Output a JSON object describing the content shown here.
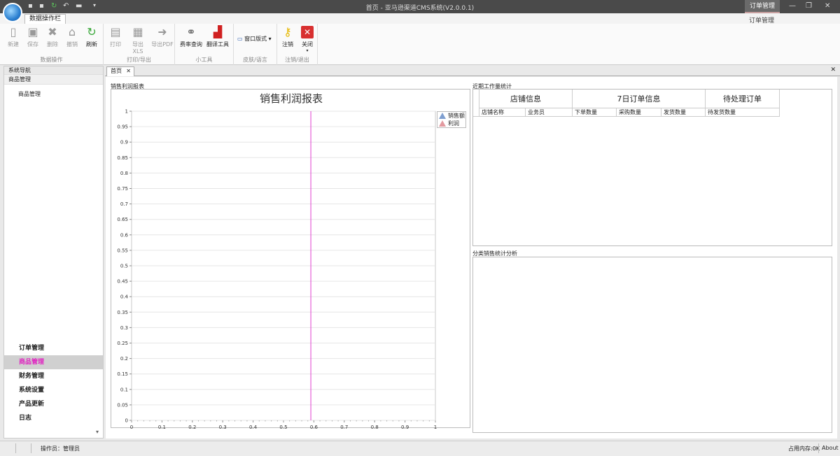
{
  "window": {
    "title": "首页 - 亚马逊渠道CMS系统(V2.0.0.1)",
    "context_tab": "订单管理",
    "context_group": "订单管理"
  },
  "ribbon": {
    "tab": "数据操作栏",
    "groups": [
      {
        "label": "数据操作",
        "buttons": [
          "新建",
          "保存",
          "删除",
          "撤销",
          "刷新"
        ]
      },
      {
        "label": "打印/导出",
        "buttons": [
          "打印",
          "导出XLS",
          "导出PDF"
        ]
      },
      {
        "label": "小工具",
        "buttons": [
          "费率查询",
          "翻译工具"
        ]
      },
      {
        "label": "皮肤/语言",
        "buttons": [
          "窗口版式"
        ]
      },
      {
        "label": "注销/退出",
        "buttons": [
          "注销",
          "关闭"
        ]
      }
    ]
  },
  "nav": {
    "header": "系统导航",
    "group_title": "商品管理",
    "sub_item": "商品管理",
    "groups": [
      "订单管理",
      "商品管理",
      "财务管理",
      "系统设置",
      "产品更新",
      "日志"
    ],
    "active_group": "商品管理"
  },
  "doc_tab": {
    "label": "首页"
  },
  "sales_panel": {
    "title": "销售利润报表"
  },
  "chart_data": {
    "type": "line",
    "title": "销售利润报表",
    "series": [
      {
        "name": "销售额",
        "color": "#7f9fd0",
        "values": []
      },
      {
        "name": "利润",
        "color": "#e39aa0",
        "values": []
      }
    ],
    "xlim": [
      0,
      1
    ],
    "ylim": [
      0,
      1
    ],
    "xticks": [
      "0",
      "0.1",
      "0.2",
      "0.3",
      "0.4",
      "0.5",
      "0.6",
      "0.7",
      "0.8",
      "0.9",
      "1"
    ],
    "yticks": [
      "0",
      "0.05",
      "0.1",
      "0.15",
      "0.2",
      "0.25",
      "0.3",
      "0.35",
      "0.4",
      "0.45",
      "0.5",
      "0.55",
      "0.6",
      "0.65",
      "0.7",
      "0.75",
      "0.8",
      "0.85",
      "0.9",
      "0.95",
      "1"
    ],
    "cursor_x": 0.59,
    "cursor_color": "#e040d0",
    "grid": true,
    "legend": "top-right"
  },
  "workload": {
    "title": "近期工作量统计",
    "header_groups": [
      "店铺信息",
      "7日订单信息",
      "待处理订单"
    ],
    "columns": [
      "店铺名称",
      "业务员",
      "下单数量",
      "采购数量",
      "发货数量",
      "待发货数量"
    ]
  },
  "category_panel": {
    "title": "分类销售统计分析"
  },
  "status": {
    "operator": "操作员：管理员",
    "memory": "占用内存:0K",
    "about": "About"
  }
}
